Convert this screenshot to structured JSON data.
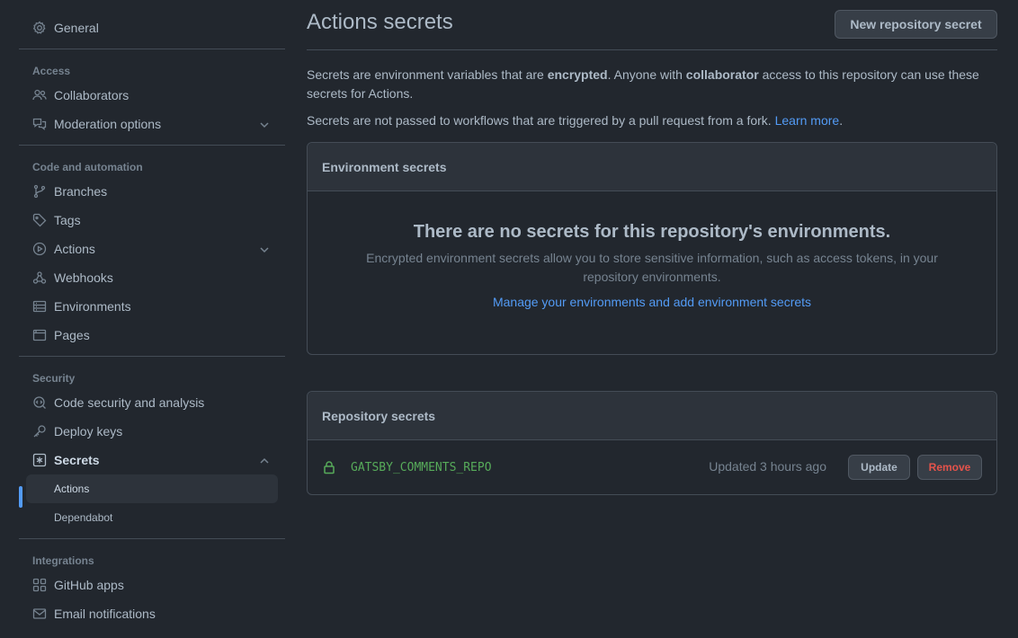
{
  "sidebar": {
    "general": "General",
    "sections": {
      "access": "Access",
      "code": "Code and automation",
      "security": "Security",
      "integrations": "Integrations"
    },
    "items": {
      "collaborators": "Collaborators",
      "moderation": "Moderation options",
      "branches": "Branches",
      "tags": "Tags",
      "actions": "Actions",
      "webhooks": "Webhooks",
      "environments": "Environments",
      "pages": "Pages",
      "code_security": "Code security and analysis",
      "deploy_keys": "Deploy keys",
      "secrets": "Secrets",
      "secrets_actions": "Actions",
      "secrets_dependabot": "Dependabot",
      "github_apps": "GitHub apps",
      "email_notifications": "Email notifications"
    }
  },
  "main": {
    "title": "Actions secrets",
    "new_secret_button": "New repository secret",
    "desc": {
      "p1_a": "Secrets are environment variables that are ",
      "p1_b": "encrypted",
      "p1_c": ". Anyone with ",
      "p1_d": "collaborator",
      "p1_e": " access to this repository can use these secrets for Actions.",
      "p2": "Secrets are not passed to workflows that are triggered by a pull request from a fork. ",
      "learn_more": "Learn more",
      "p2_end": "."
    },
    "env_box": {
      "header": "Environment secrets",
      "blank_title": "There are no secrets for this repository's environments.",
      "blank_text": "Encrypted environment secrets allow you to store sensitive information, such as access tokens, in your repository environments.",
      "manage_link": "Manage your environments and add environment secrets"
    },
    "repo_box": {
      "header": "Repository secrets",
      "secrets": [
        {
          "name": "GATSBY_COMMENTS_REPO",
          "updated": "Updated 3 hours ago",
          "update_label": "Update",
          "remove_label": "Remove"
        }
      ]
    }
  },
  "colors": {
    "background": "#22272e",
    "accent": "#539bf5",
    "success": "#57ab5a",
    "danger": "#e5534b"
  }
}
